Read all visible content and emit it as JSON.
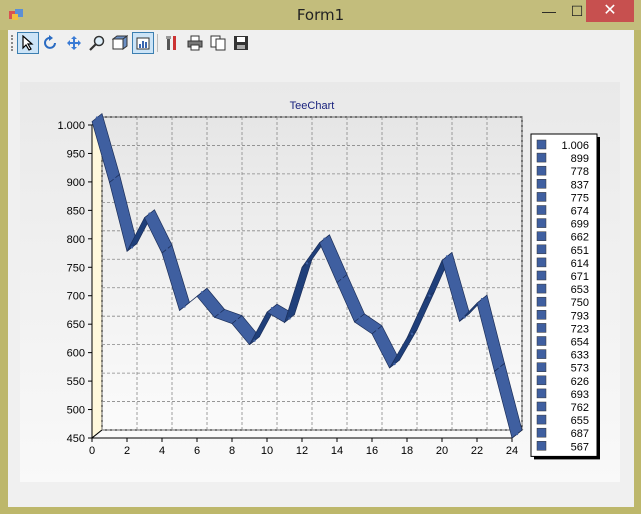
{
  "window": {
    "title": "Form1",
    "minimize_glyph": "—",
    "maximize_glyph": "☐",
    "close_glyph": "✕"
  },
  "toolbar": {
    "icons": [
      "pointer-icon",
      "rotate-icon",
      "move-icon",
      "zoom-icon",
      "depth-icon",
      "3d-icon",
      "edit-icon",
      "print-icon",
      "copy-icon",
      "save-icon"
    ]
  },
  "chart_data": {
    "type": "line",
    "title": "TeeChart",
    "xlim": [
      0,
      24
    ],
    "ylim": [
      450,
      1000
    ],
    "x_ticks": [
      "0",
      "2",
      "4",
      "6",
      "8",
      "10",
      "12",
      "14",
      "16",
      "18",
      "20",
      "22",
      "24"
    ],
    "y_ticks": [
      "450",
      "500",
      "550",
      "600",
      "650",
      "700",
      "750",
      "800",
      "850",
      "900",
      "950",
      "1.000"
    ],
    "grid": true,
    "legend_position": "right",
    "series_color": "#3f5fa0",
    "x": [
      0,
      1,
      2,
      3,
      4,
      5,
      6,
      7,
      8,
      9,
      10,
      11,
      12,
      13,
      14,
      15,
      16,
      17,
      18,
      19,
      20,
      21,
      22,
      23,
      24
    ],
    "values": [
      1006,
      899,
      778,
      837,
      775,
      674,
      699,
      662,
      651,
      614,
      671,
      653,
      750,
      793,
      723,
      654,
      633,
      573,
      626,
      693,
      762,
      655,
      687,
      567,
      450
    ],
    "legend_labels": [
      "1.006",
      "899",
      "778",
      "837",
      "775",
      "674",
      "699",
      "662",
      "651",
      "614",
      "671",
      "653",
      "750",
      "793",
      "723",
      "654",
      "633",
      "573",
      "626",
      "693",
      "762",
      "655",
      "687",
      "567"
    ]
  }
}
